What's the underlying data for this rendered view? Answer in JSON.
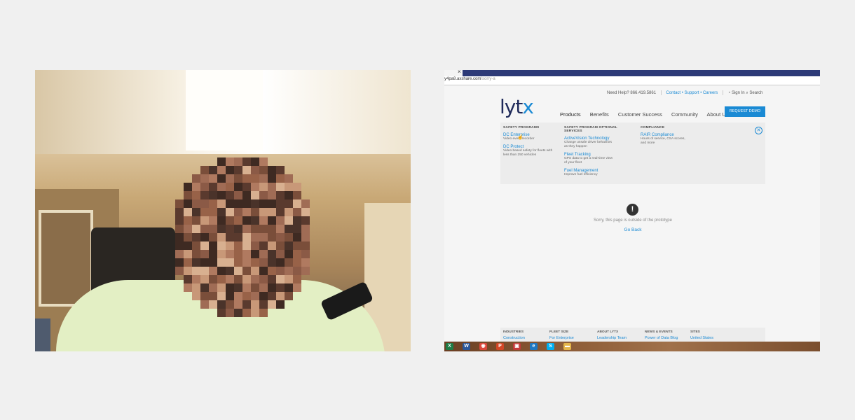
{
  "browser": {
    "tab_close": "×",
    "url_host": "y4pa8.axshare.com",
    "url_path": "/sorry-a"
  },
  "site": {
    "need_help": "Need Help? 866.419.5861",
    "contact_links": "Contact • Support • Careers",
    "sign_in": "Sign In",
    "search": "Search",
    "logo_text": "lyt",
    "logo_accent": "x",
    "nav": [
      "Products",
      "Benefits",
      "Customer Success",
      "Community",
      "About Us"
    ],
    "request_demo": "REQUEST DEMO",
    "dropdown": {
      "col1": {
        "heading": "SAFETY PROGRAMS",
        "items": [
          {
            "link": "DC Enterprise",
            "desc": [
              "Video event recorder"
            ]
          },
          {
            "link": "DC Protect",
            "desc": [
              "Video based safety for fleets with",
              "less than 250 vehicles"
            ]
          }
        ]
      },
      "col2": {
        "heading": "SAFETY PROGRAM OPTIONAL SERVICES",
        "items": [
          {
            "link": "ActiveVision Technology",
            "desc": [
              "Change unsafe driver behaviors",
              "as they happen"
            ]
          },
          {
            "link": "Fleet Tracking",
            "desc": [
              "GPS data to get a real-time view",
              "of your fleet"
            ]
          },
          {
            "link": "Fuel Management",
            "desc": [
              "Improve fuel efficiency"
            ]
          }
        ]
      },
      "col3": {
        "heading": "COMPLIANCE",
        "items": [
          {
            "link": "RAIR Compliance",
            "desc": [
              "Hours of service, CSA scores,",
              "and more"
            ]
          }
        ]
      },
      "close_symbol": "✕"
    },
    "error": {
      "icon_symbol": "!",
      "message": "Sorry, this page is outside of the prototype",
      "go_back": "Go Back"
    },
    "footer": [
      {
        "heading": "INDUSTRIES",
        "link": "Construction"
      },
      {
        "heading": "FLEET SIZE",
        "link": "For Enterprise"
      },
      {
        "heading": "ABOUT LYTX",
        "link": "Leadership Team"
      },
      {
        "heading": "NEWS & EVENTS",
        "link": "Power of Data Blog"
      },
      {
        "heading": "SITES",
        "link": "United States"
      }
    ]
  },
  "taskbar": {
    "icons": [
      {
        "name": "excel-icon",
        "glyph": "X",
        "color": "#1e7b45"
      },
      {
        "name": "word-icon",
        "glyph": "W",
        "color": "#2b579a"
      },
      {
        "name": "chrome-icon",
        "glyph": "◉",
        "color": "#d9473b"
      },
      {
        "name": "powerpoint-icon",
        "glyph": "P",
        "color": "#d24726"
      },
      {
        "name": "app-icon",
        "glyph": "▣",
        "color": "#c43a3a"
      },
      {
        "name": "ie-icon",
        "glyph": "e",
        "color": "#1f78c1"
      },
      {
        "name": "skype-icon",
        "glyph": "S",
        "color": "#00aff0"
      },
      {
        "name": "folder-icon",
        "glyph": "▬",
        "color": "#e4b44a"
      }
    ]
  }
}
